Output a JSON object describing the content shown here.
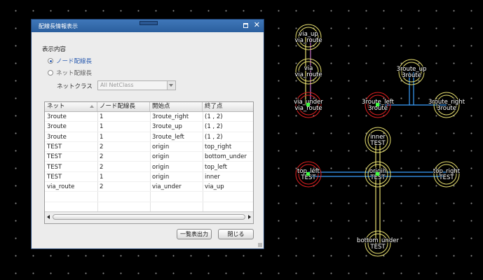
{
  "dialog": {
    "title": "配線長情報表示",
    "section_label": "表示内容",
    "radio_node": "ノード配線長",
    "radio_net": "ネット配線長",
    "netclass_label": "ネットクラス",
    "netclass_value": "All NetClass",
    "columns": [
      "ネット",
      "ノード配線長",
      "開始点",
      "終了点"
    ],
    "rows": [
      [
        "3route",
        "1",
        "3route_right",
        "(1 , 2)"
      ],
      [
        "3route",
        "1",
        "3route_up",
        "(1 , 2)"
      ],
      [
        "3route",
        "1",
        "3route_left",
        "(1 , 2)"
      ],
      [
        "TEST",
        "2",
        "origin",
        "top_right"
      ],
      [
        "TEST",
        "2",
        "origin",
        "bottom_under"
      ],
      [
        "TEST",
        "2",
        "origin",
        "top_left"
      ],
      [
        "TEST",
        "1",
        "origin",
        "inner"
      ],
      [
        "via_route",
        "2",
        "via_under",
        "via_up"
      ],
      [
        "",
        "",
        "",
        ""
      ],
      [
        "",
        "",
        "",
        ""
      ]
    ],
    "export_button": "一覧表出力",
    "close_button": "閉じる"
  },
  "board": {
    "colors": {
      "background": "#000000",
      "pad_red": "#e02020",
      "pad_yellow": "#e8e070",
      "trace_blue": "#3aa0ff",
      "via_green": "#40ff40"
    },
    "pads": [
      {
        "name": "via_up",
        "net": "via_route",
        "color": "yellow"
      },
      {
        "name": "via",
        "net": "via_route",
        "color": "yellow"
      },
      {
        "name": "via_under",
        "net": "via_route",
        "color": "red"
      },
      {
        "name": "3route_up",
        "net": "3route",
        "color": "yellow"
      },
      {
        "name": "3route_left",
        "net": "3route",
        "color": "red"
      },
      {
        "name": "3route_right",
        "net": "3route",
        "color": "yellow"
      },
      {
        "name": "inner",
        "net": "TEST",
        "color": "yellow"
      },
      {
        "name": "top_left",
        "net": "TEST",
        "color": "red"
      },
      {
        "name": "origin",
        "net": "TEST",
        "color": "yellow"
      },
      {
        "name": "top_right",
        "net": "TEST",
        "color": "yellow"
      },
      {
        "name": "bottom_under",
        "net": "TEST",
        "color": "yellow"
      }
    ]
  }
}
